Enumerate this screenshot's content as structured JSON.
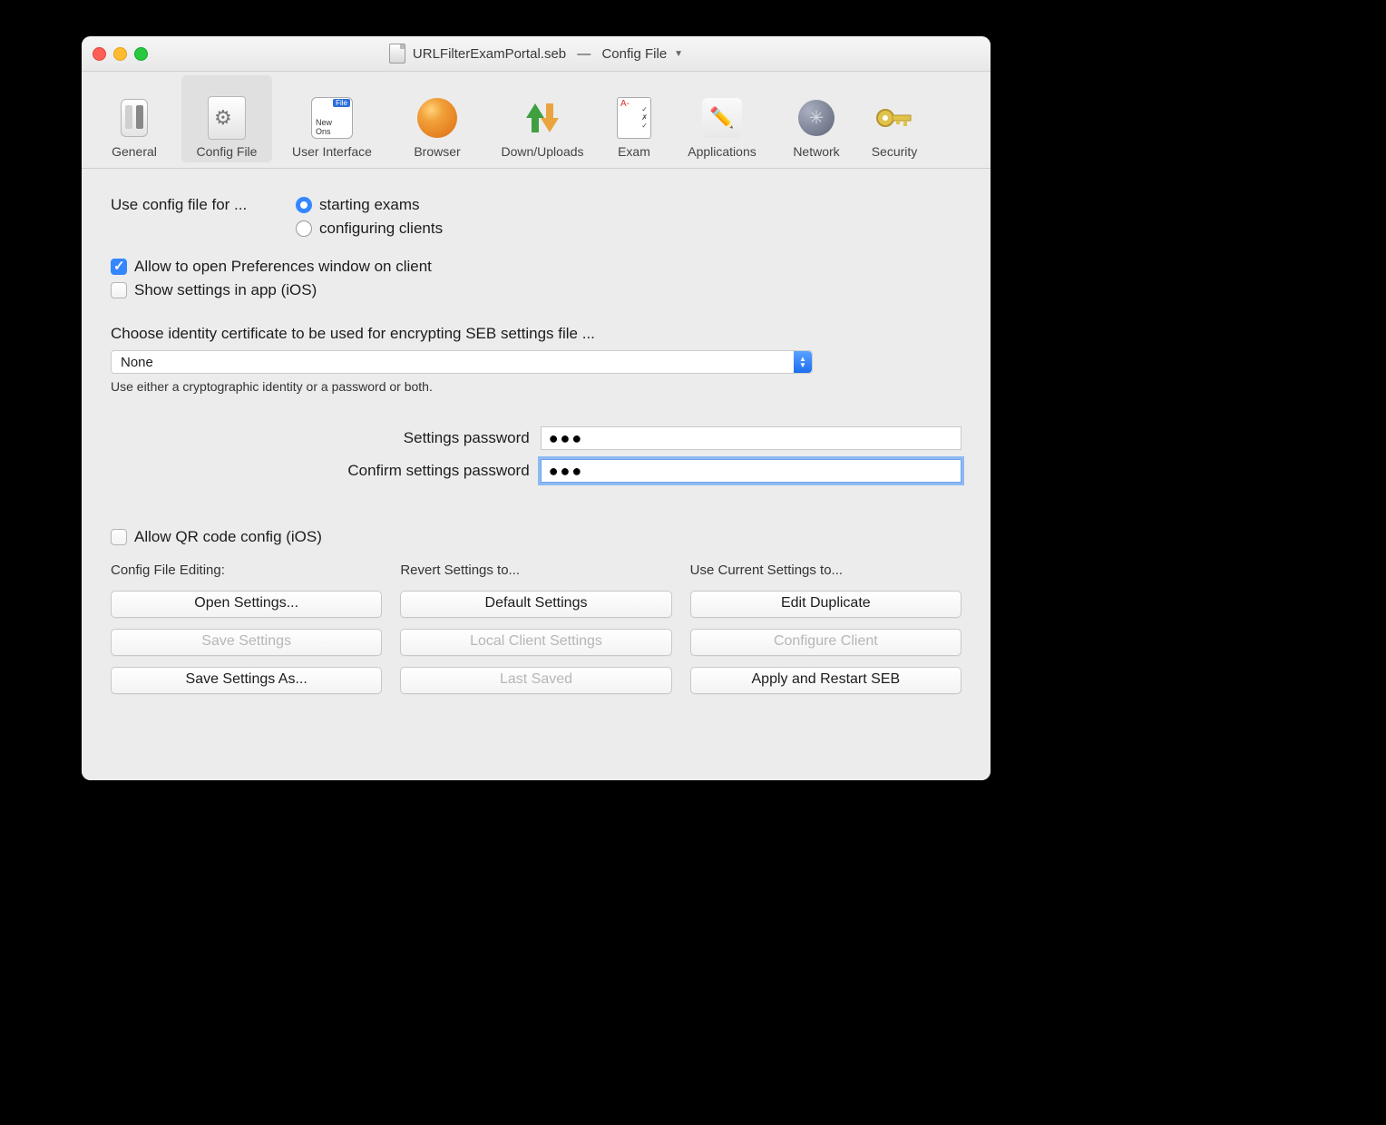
{
  "window": {
    "title": "URLFilterExamPortal.seb",
    "subtitle": "Config File"
  },
  "toolbar": {
    "items": [
      {
        "label": "General"
      },
      {
        "label": "Config File"
      },
      {
        "label": "User Interface"
      },
      {
        "label": "Browser"
      },
      {
        "label": "Down/Uploads"
      },
      {
        "label": "Exam"
      },
      {
        "label": "Applications"
      },
      {
        "label": "Network"
      },
      {
        "label": "Security"
      }
    ],
    "selected": "Config File"
  },
  "form": {
    "use_config_for_label": "Use config file for ...",
    "radio_start": "starting exams",
    "radio_configure": "configuring clients",
    "chk_allow_prefs": "Allow to open Preferences window on client",
    "chk_show_settings_ios": "Show settings in app (iOS)",
    "cert_label": "Choose identity certificate to be used for encrypting SEB settings file ...",
    "cert_value": "None",
    "cert_hint": "Use either a cryptographic identity or a password or both.",
    "settings_password_label": "Settings password",
    "confirm_password_label": "Confirm settings password",
    "password_value_masked": "●●●",
    "chk_allow_qr": "Allow QR code config (iOS)"
  },
  "columns": {
    "editing": {
      "header": "Config File Editing:",
      "buttons": [
        {
          "label": "Open Settings...",
          "enabled": true
        },
        {
          "label": "Save Settings",
          "enabled": false
        },
        {
          "label": "Save Settings As...",
          "enabled": true
        }
      ]
    },
    "revert": {
      "header": "Revert Settings to...",
      "buttons": [
        {
          "label": "Default Settings",
          "enabled": true
        },
        {
          "label": "Local Client Settings",
          "enabled": false
        },
        {
          "label": "Last Saved",
          "enabled": false
        }
      ]
    },
    "use": {
      "header": "Use Current Settings to...",
      "buttons": [
        {
          "label": "Edit Duplicate",
          "enabled": true
        },
        {
          "label": "Configure Client",
          "enabled": false
        },
        {
          "label": "Apply and Restart SEB",
          "enabled": true
        }
      ]
    }
  }
}
